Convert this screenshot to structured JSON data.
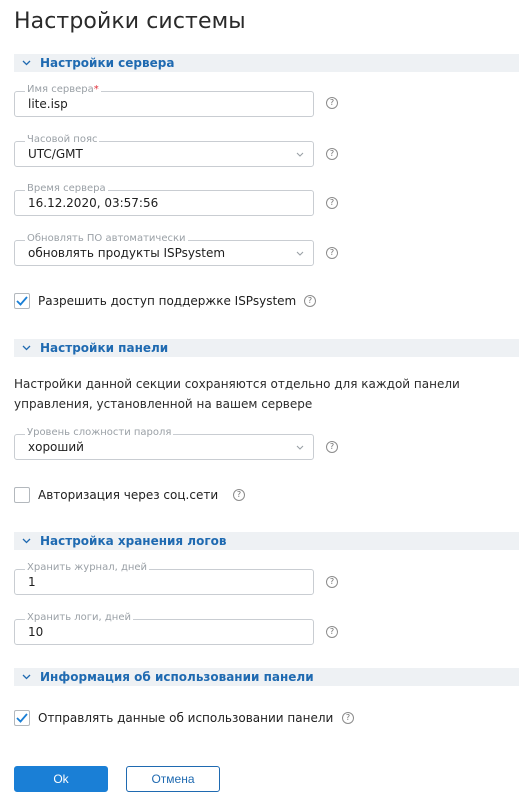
{
  "page": {
    "title": "Настройки системы"
  },
  "sections": {
    "server": {
      "title": "Настройки сервера"
    },
    "panel": {
      "title": "Настройки панели",
      "note": "Настройки данной секции сохраняются отдельно для каждой панели управления, установленной на вашем сервере"
    },
    "logs": {
      "title": "Настройка хранения логов"
    },
    "usage": {
      "title": "Информация об использовании панели"
    }
  },
  "fields": {
    "server_name": {
      "label": "Имя сервера",
      "required_mark": "*",
      "value": "lite.isp"
    },
    "timezone": {
      "label": "Часовой пояс",
      "value": "UTC/GMT"
    },
    "server_time": {
      "label": "Время сервера",
      "value": "16.12.2020, 03:57:56"
    },
    "auto_update": {
      "label": "Обновлять ПО автоматически",
      "value": "обновлять продукты ISPsystem"
    },
    "password_level": {
      "label": "Уровень сложности пароля",
      "value": "хороший"
    },
    "journal_days": {
      "label": "Хранить журнал, дней",
      "value": "1"
    },
    "logs_days": {
      "label": "Хранить логи, дней",
      "value": "10"
    }
  },
  "checkboxes": {
    "support_access": {
      "label": "Разрешить доступ поддержке ISPsystem",
      "checked": true
    },
    "social_auth": {
      "label": "Авторизация через соц.сети",
      "checked": false
    },
    "send_usage": {
      "label": "Отправлять данные об использовании панели",
      "checked": true
    }
  },
  "help": {
    "glyph": "?"
  },
  "buttons": {
    "ok": "Ok",
    "cancel": "Отмена"
  },
  "colors": {
    "accent": "#1a7fd6",
    "section_text": "#1f6ab1",
    "section_bg": "#eef1f4",
    "required": "#e0303a"
  }
}
